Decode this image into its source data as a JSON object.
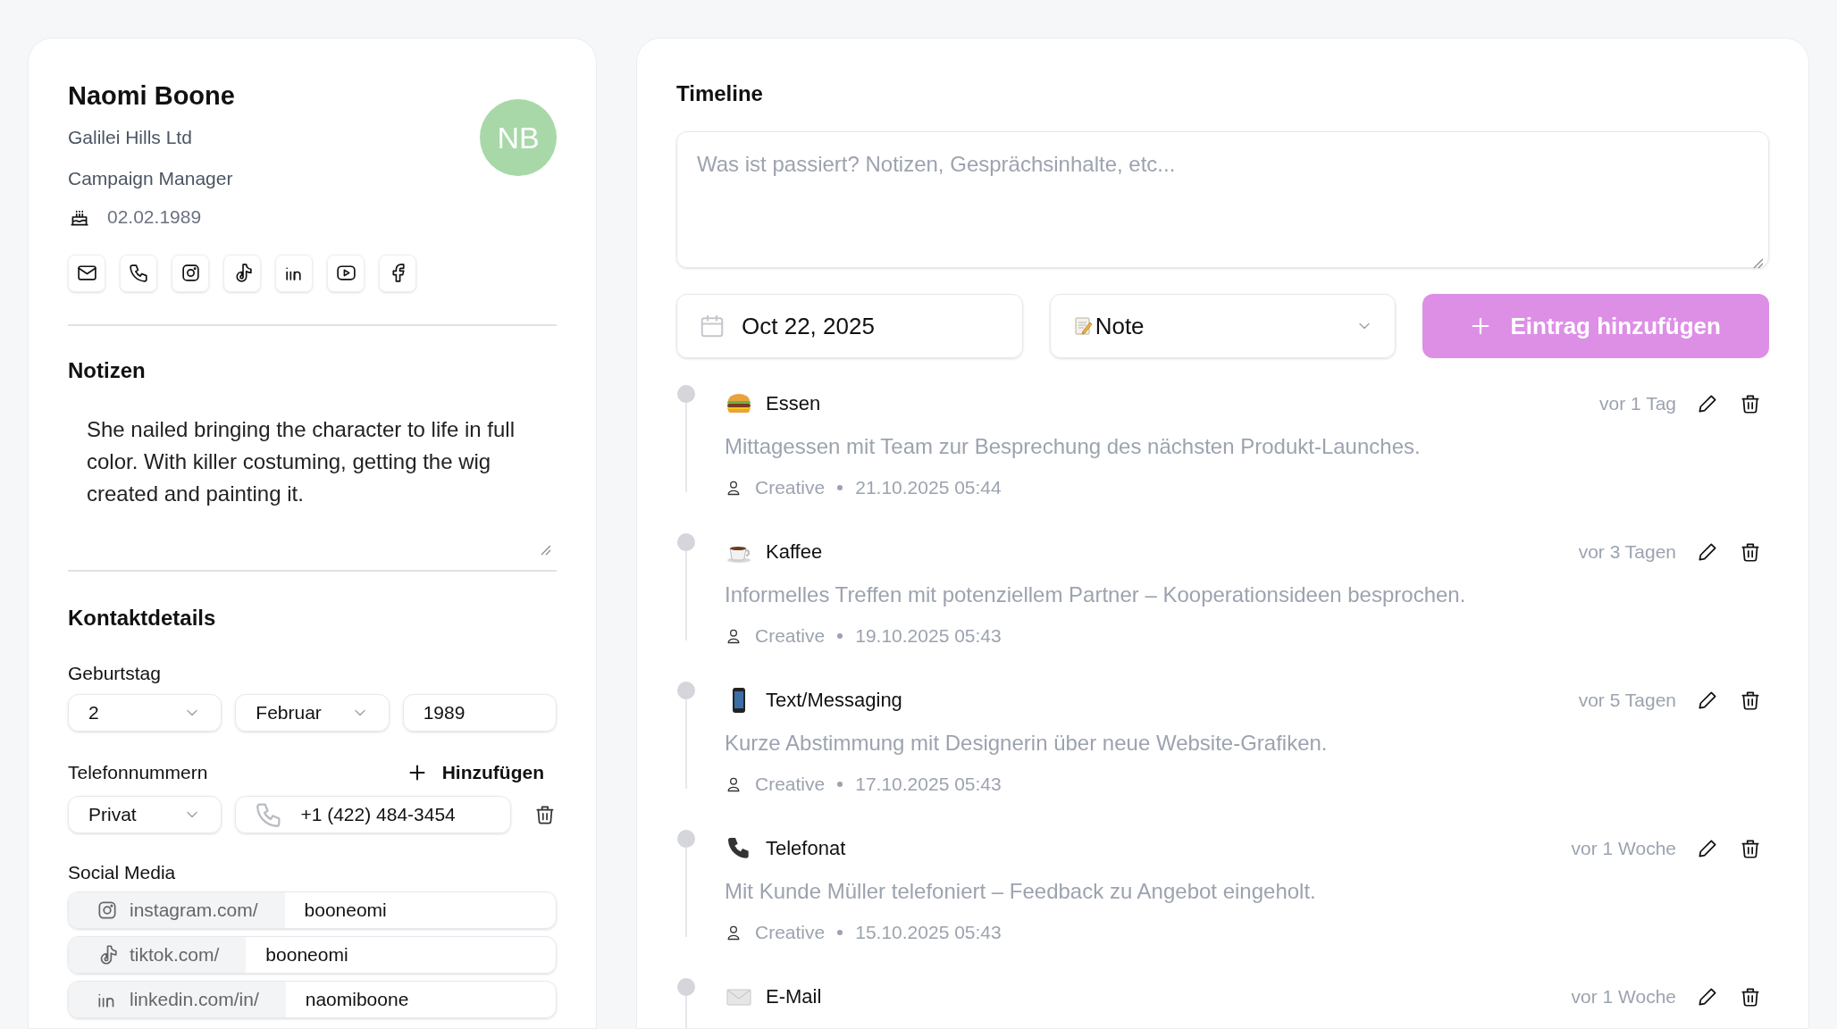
{
  "contact": {
    "name": "Naomi Boone",
    "company": "Galilei Hills Ltd",
    "role": "Campaign Manager",
    "birthday": "02.02.1989",
    "avatar_initials": "NB"
  },
  "contact_links": [
    {
      "kind": "email"
    },
    {
      "kind": "phone"
    },
    {
      "kind": "instagram"
    },
    {
      "kind": "tiktok"
    },
    {
      "kind": "linkedin"
    },
    {
      "kind": "youtube"
    },
    {
      "kind": "facebook"
    }
  ],
  "notes": {
    "title": "Notizen",
    "text": "She nailed bringing the character to life in full color. With killer costuming, getting the wig created and painting it."
  },
  "details": {
    "title": "Kontaktdetails",
    "birthday": {
      "label": "Geburtstag",
      "day": "2",
      "month": "Februar",
      "year": "1989"
    },
    "phones": {
      "label": "Telefonnummern",
      "add_label": "Hinzufügen",
      "items": [
        {
          "type": "Privat",
          "number": "+1 (422) 484-3454"
        }
      ]
    },
    "social": {
      "label": "Social Media",
      "items": [
        {
          "kind": "instagram",
          "prefix": "instagram.com/",
          "handle": "booneomi"
        },
        {
          "kind": "tiktok",
          "prefix": "tiktok.com/",
          "handle": "booneomi"
        },
        {
          "kind": "linkedin",
          "prefix": "linkedin.com/in/",
          "handle": "naomiboone"
        }
      ]
    }
  },
  "timeline": {
    "title": "Timeline",
    "placeholder": "Was ist passiert? Notizen, Gesprächsinhalte, etc...",
    "date": "Oct 22, 2025",
    "entry_type": {
      "kind": "note",
      "label": "Note"
    },
    "add_button": "Eintrag hinzufügen",
    "entries": [
      {
        "kind": "food",
        "title": "Essen",
        "ago": "vor 1 Tag",
        "text": "Mittagessen mit Team zur Besprechung des nächsten Produkt-Launches.",
        "author": "Creative",
        "timestamp": "21.10.2025 05:44"
      },
      {
        "kind": "coffee",
        "title": "Kaffee",
        "ago": "vor 3 Tagen",
        "text": "Informelles Treffen mit potenziellem Partner – Kooperationsideen besprochen.",
        "author": "Creative",
        "timestamp": "19.10.2025 05:43"
      },
      {
        "kind": "message",
        "title": "Text/Messaging",
        "ago": "vor 5 Tagen",
        "text": "Kurze Abstimmung mit Designerin über neue Website-Grafiken.",
        "author": "Creative",
        "timestamp": "17.10.2025 05:43"
      },
      {
        "kind": "call",
        "title": "Telefonat",
        "ago": "vor 1 Woche",
        "text": "Mit Kunde Müller telefoniert – Feedback zu Angebot eingeholt.",
        "author": "Creative",
        "timestamp": "15.10.2025 05:43"
      },
      {
        "kind": "email",
        "title": "E-Mail",
        "ago": "vor 1 Woche"
      }
    ]
  }
}
